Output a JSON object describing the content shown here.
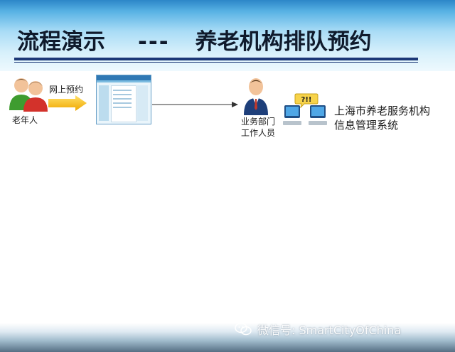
{
  "slide": {
    "title": "流程演示",
    "title_dash": "---",
    "title_subject": "养老机构排队预约"
  },
  "flow": {
    "elder_label": "老年人",
    "arrow_label": "网上预约",
    "worker_label_line1": "业务部门",
    "worker_label_line2": "工作人员",
    "bubble_text": "?!!",
    "system_name": "上海市养老服务机构信息管理系统"
  },
  "watermark": {
    "text": "微信号: SmartCityOfChina"
  },
  "colors": {
    "title_rule": "#1c3877",
    "arrow_fill": "#f5b400",
    "elder_shirt_green": "#3e9c2f",
    "elder_shirt_red": "#d3322b",
    "worker_suit": "#1e3f7a"
  },
  "icons": [
    "elders-icon",
    "arrow-right-icon",
    "website-thumbnail",
    "worker-icon",
    "computers-icon",
    "wechat-icon"
  ]
}
